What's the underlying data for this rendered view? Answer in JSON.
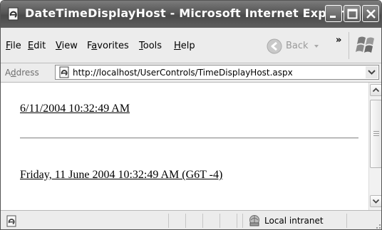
{
  "window": {
    "title": "DateTimeDisplayHost - Microsoft Internet Explorer"
  },
  "menu": {
    "items": [
      {
        "underline": "F",
        "rest": "ile"
      },
      {
        "underline": "E",
        "rest": "dit"
      },
      {
        "underline": "V",
        "rest": "iew"
      },
      {
        "pre": "F",
        "underline": "a",
        "rest": "vorites"
      },
      {
        "underline": "T",
        "rest": "ools"
      },
      {
        "underline": "H",
        "rest": "elp"
      }
    ],
    "back_label": "Back",
    "chevron": "»"
  },
  "address": {
    "label_pre": "A",
    "label_underline": "d",
    "label_rest": "dress",
    "url": "http://localhost/UserControls/TimeDisplayHost.aspx"
  },
  "content": {
    "short_datetime": "6/11/2004 10:32:49 AM",
    "long_datetime": "Friday, 11 June 2004 10:32:49 AM (G6T -4)"
  },
  "status": {
    "zone": "Local intranet"
  },
  "icons": {
    "app": "ie-page-icon",
    "back": "back-arrow-icon",
    "windows": "windows-flag-icon",
    "zone": "local-intranet-icon"
  }
}
